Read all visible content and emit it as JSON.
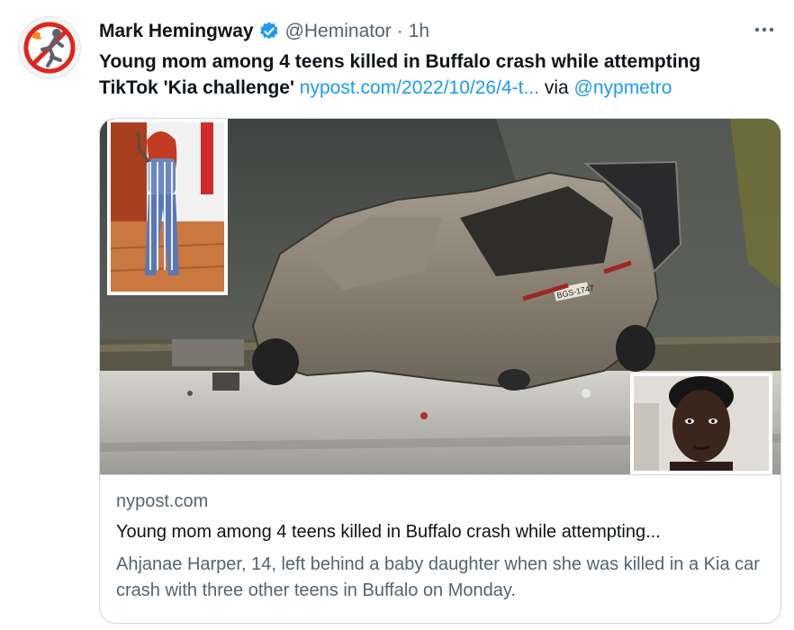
{
  "author": {
    "name": "Mark Hemingway",
    "handle": "@Heminator",
    "separator": "·",
    "time": "1h"
  },
  "tweet": {
    "text_line1": "Young mom among 4 teens killed in Buffalo crash while attempting",
    "text_line2_bold": "TikTok 'Kia challenge'",
    "link": "nypost.com/2022/10/26/4-t...",
    "via": "via",
    "mention": "@nypmetro"
  },
  "card": {
    "domain": "nypost.com",
    "title": "Young mom among 4 teens killed in Buffalo crash while attempting...",
    "description": "Ahjanae Harper, 14, left behind a baby daughter when she was killed in a Kia car crash with three other teens in Buffalo on Monday.",
    "plate": "BGS-1747"
  },
  "icons": {
    "verified": "verified-badge-icon",
    "more": "more-options-icon"
  },
  "colors": {
    "link": "#1d9bf0",
    "secondary_text": "#536471",
    "border": "#cfd9de"
  }
}
